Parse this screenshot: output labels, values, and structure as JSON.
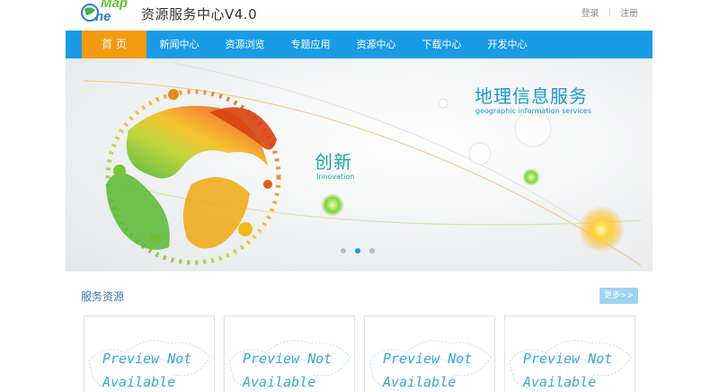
{
  "header": {
    "logo_text_top": "Map",
    "logo_text_bottom": "ne",
    "logo_initial": "O",
    "title": "资源服务中心V4.0",
    "login": "登录",
    "separator": "|",
    "register": "注册"
  },
  "nav": {
    "items": [
      {
        "label": "首 页"
      },
      {
        "label": "新闻中心"
      },
      {
        "label": "资源浏览"
      },
      {
        "label": "专题应用"
      },
      {
        "label": "资源中心"
      },
      {
        "label": "下载中心"
      },
      {
        "label": "开发中心"
      }
    ],
    "active_index": 0
  },
  "banner": {
    "title": "地理信息服务",
    "subtitle": "geographic information services",
    "innovation": "创新",
    "innovation_sub": "Innovation",
    "active_slide": 2,
    "slide_count": 3
  },
  "services": {
    "title": "服务资源",
    "more": "更多>>",
    "cards": [
      {
        "line1": "Preview Not",
        "line2": "Available"
      },
      {
        "line1": "Preview Not",
        "line2": "Available"
      },
      {
        "line1": "Preview Not",
        "line2": "Available"
      },
      {
        "line1": "Preview Not",
        "line2": "Available"
      }
    ]
  },
  "colors": {
    "nav_bg": "#1a9be6",
    "nav_active": "#f39a11",
    "section_title": "#3b77b0",
    "preview_text": "#3aa7d8"
  }
}
